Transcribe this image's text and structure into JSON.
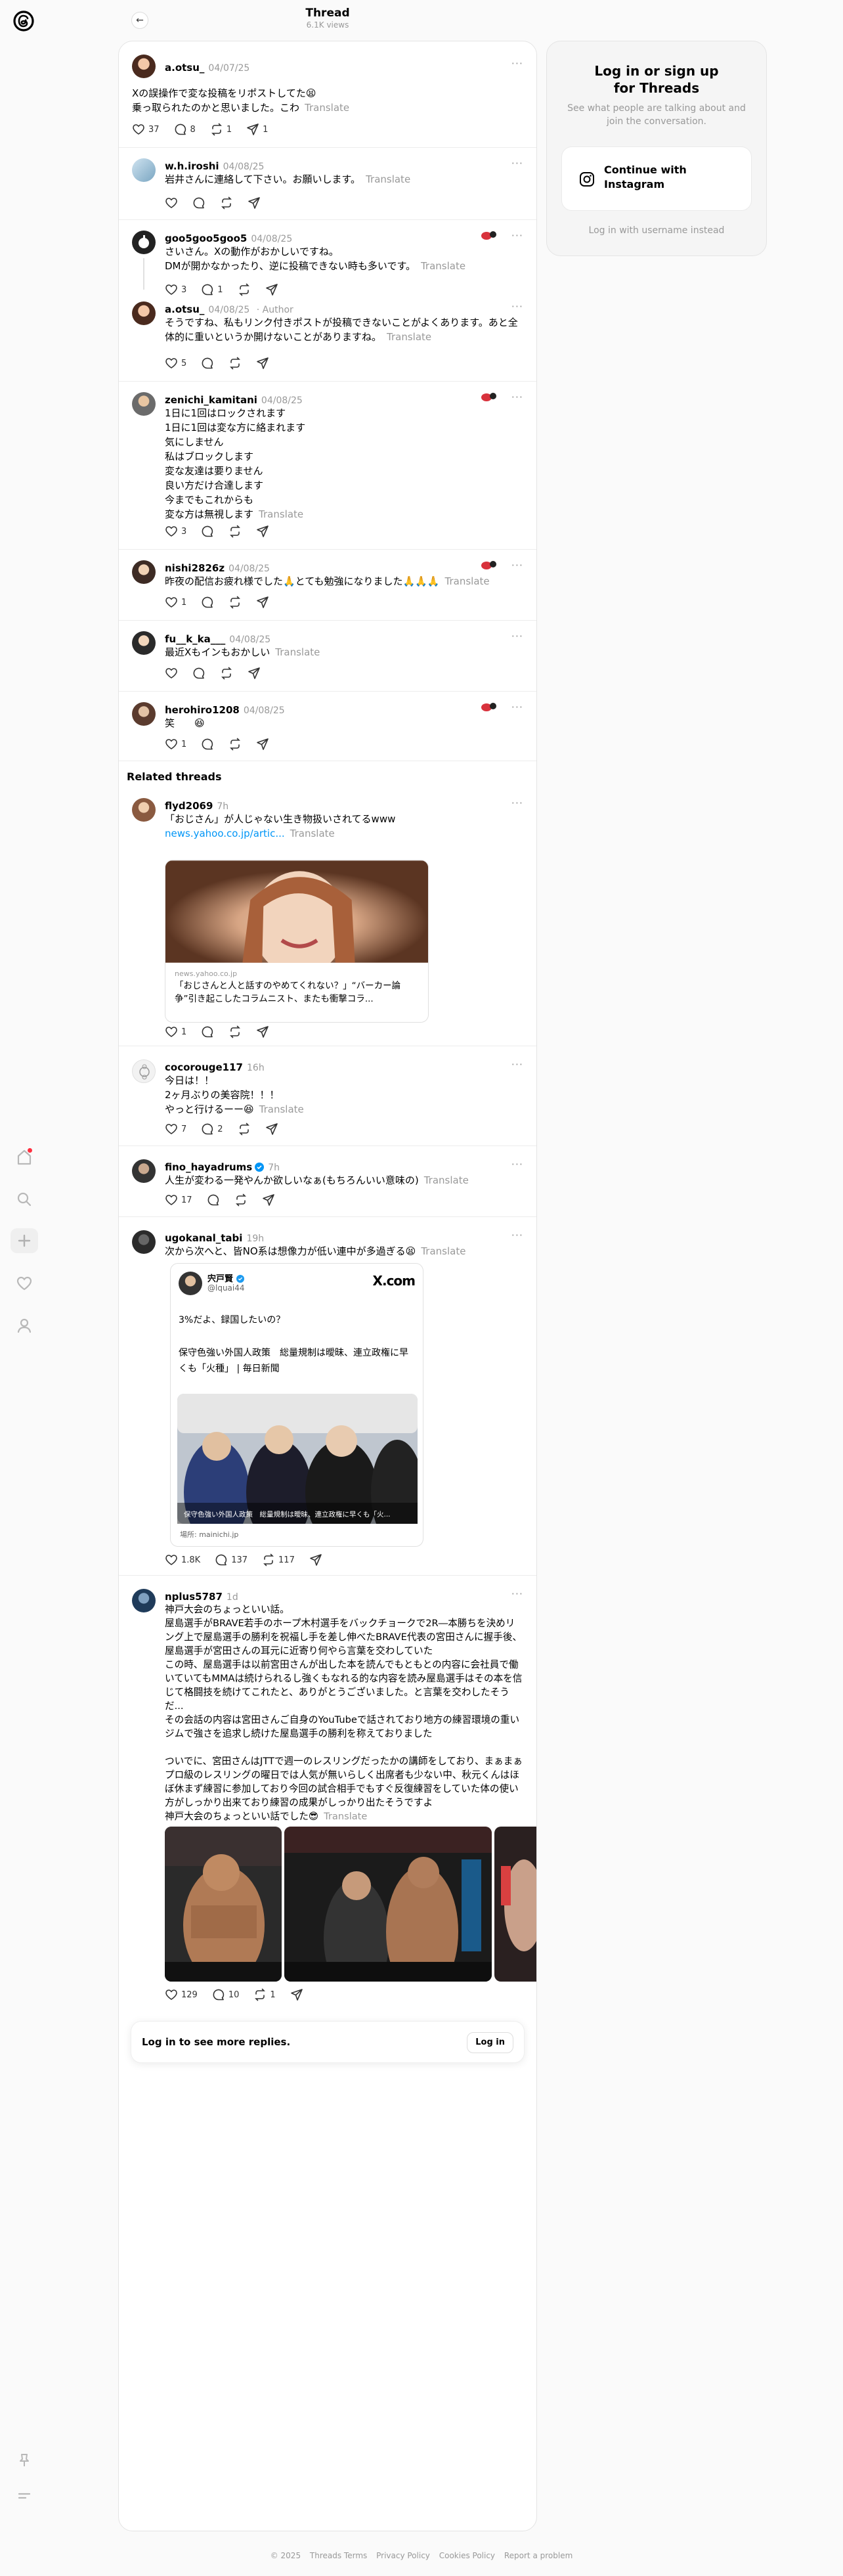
{
  "header": {
    "title": "Thread",
    "views": "6.1K views"
  },
  "posts": [
    {
      "user": "a.otsu_",
      "date": "04/07/25",
      "text": "Xの誤操作で変な投稿をリポストしてた😫\n乗っ取られたのかと思いました。こわ",
      "translate": "Translate",
      "likes": "37",
      "replies": "8",
      "reposts": "1",
      "shares": "1"
    },
    {
      "user": "w.h.iroshi",
      "date": "04/08/25",
      "text": "岩井さんに連絡して下さい。お願いします。",
      "translate": "Translate"
    },
    {
      "user": "goo5goo5goo5",
      "date": "04/08/25",
      "text": "さいさん。Xの動作がおかしいですね。\nDMが開かなかったり、逆に投稿できない時も多いです。",
      "translate": "Translate",
      "likes": "3",
      "replies": "1"
    },
    {
      "user": "a.otsu_",
      "date": "04/08/25",
      "author": "Author",
      "text": "そうですね、私もリンク付きポストが投稿できないことがよくあります。あと全体的に重いというか開けないことがありますね。",
      "translate": "Translate",
      "likes": "5"
    },
    {
      "user": "zenichi_kamitani",
      "date": "04/08/25",
      "text": "1日に1回はロックされます\n1日に1回は変な方に絡まれます\n気にしません\n私はブロックします\n変な友達は要りません\n良い方だけ合達します\n今までもこれからも\n変な方は無視します",
      "translate": "Translate",
      "likes": "3"
    },
    {
      "user": "nishi2826z",
      "date": "04/08/25",
      "text": "昨夜の配信お疲れ様でした🙏とても勉強になりました🙏🙏🙏",
      "translate": "Translate",
      "likes": "1"
    },
    {
      "user": "fu__k_ka___",
      "date": "04/08/25",
      "text": "最近Xもインもおかしい",
      "translate": "Translate"
    },
    {
      "user": "herohiro1208",
      "date": "04/08/25",
      "text": "笑　　😆",
      "likes": "1"
    }
  ],
  "related": {
    "title": "Related threads",
    "items": [
      {
        "user": "flyd2069",
        "date": "7h",
        "text": "「おじさん」が人じゃない生き物扱いされてるwww",
        "link": "news.yahoo.co.jp/artic...",
        "translate": "Translate",
        "card_source": "news.yahoo.co.jp",
        "card_title": "「おじさんと人と話すのやめてくれない？」“バーカー論争”引き起こしたコラムニスト、またも衝撃コラ...",
        "likes": "1"
      },
      {
        "user": "cocorouge117",
        "date": "16h",
        "text": "今日は！！\n2ヶ月ぶりの美容院！！！\nやっと行けるーー😆",
        "translate": "Translate",
        "likes": "7",
        "replies": "2"
      },
      {
        "user": "fino_hayadrums",
        "date": "7h",
        "text": "人生が変わる一発やんか欲しいなぁ(もちろんいい意味の)",
        "translate": "Translate",
        "likes": "17"
      },
      {
        "user": "ugokanal_tabi",
        "date": "19h",
        "text": "次から次へと、皆NO系は想像力が低い連中が多過ぎる😫",
        "translate": "Translate",
        "x_name": "宍戸賢",
        "x_handle": "@lquai44",
        "x_logo": "X.com",
        "x_text1": "3%だよ、録国したいの？",
        "x_text2": "保守色強い外国人政策　総量規制は曖昧、連立政権に早くも「火種」 | 毎日新聞",
        "x_caption": "保守色強い外国人政策　総量規制は曖昧、連立政権に早くも「火...",
        "x_site": "場所: mainichi.jp",
        "likes": "1.8K",
        "replies": "137",
        "reposts": "117"
      },
      {
        "user": "nplus5787",
        "date": "1d",
        "text": "神戸大会のちょっといい話。\n屋島選手がBRAVE若手のホープ木村選手をバックチョークで2R―本勝ちを決めリング上で屋島選手の勝利を祝福し手を差し伸べたBRAVE代表の宮田さんに握手後、屋島選手が宮田さんの耳元に近寄り何やら言葉を交わしていた\nこの時、屋島選手は以前宮田さんが出した本を読んでもともとの内容に会社員で働いていてもMMAは続けられるし強くもなれる的な内容を読み屋島選手はその本を信じて格闘技を続けてこれたと、ありがとうございました。と言葉を交わしたそうだ...\nその会話の内容は宮田さんご自身のYouTubeで話されており地方の練習環境の重いジムで強さを追求し続けた屋島選手の勝利を称えておりました\n\nついでに、宮田さんはJTTで週一のレスリングだったかの講師をしており、まぁまぁプロ級のレスリングの曜日では人気が無いらしく出席者も少ない中、秋元くんはほぼ休まず練習に参加しており今回の試合相手でもすぐ反復練習をしていた体の使い方がしっかり出来ており練習の成果がしっかり出たそうですよ\n神戸大会のちょっといい話でした😎",
        "translate": "Translate",
        "likes": "129",
        "replies": "10",
        "reposts": "1"
      }
    ]
  },
  "login_bar": {
    "text": "Log in to see more replies.",
    "button": "Log in"
  },
  "side": {
    "title": "Log in or sign up\nfor Threads",
    "subtitle": "See what people are talking about and join the conversation.",
    "instagram": "Continue with\nInstagram",
    "username": "Log in with username instead"
  },
  "footer": {
    "copyright": "© 2025",
    "terms": "Threads Terms",
    "privacy": "Privacy Policy",
    "cookies": "Cookies Policy",
    "report": "Report a problem"
  },
  "icons": [
    "threads-logo-icon",
    "home-icon",
    "search-icon",
    "plus-icon",
    "heart-icon",
    "profile-icon",
    "pin-icon",
    "menu-icon",
    "like-icon",
    "reply-icon",
    "repost-icon",
    "share-icon",
    "more-icon",
    "back-arrow-icon",
    "instagram-icon"
  ],
  "colors": {
    "accent": "#000000",
    "notification": "#ff3040",
    "muted": "#999999",
    "link": "#0095f6"
  }
}
